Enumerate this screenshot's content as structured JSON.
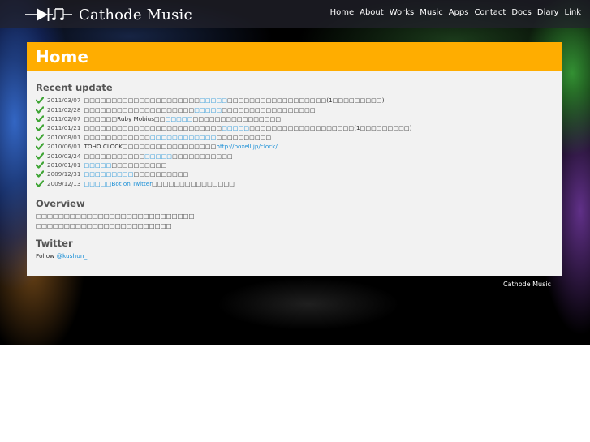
{
  "site": {
    "name": "Cathode Music",
    "logo_icon": "diode-music-note-icon"
  },
  "nav": [
    "Home",
    "About",
    "Works",
    "Music",
    "Apps",
    "Contact",
    "Docs",
    "Diary",
    "Link"
  ],
  "page": {
    "title": "Home"
  },
  "recent": {
    "heading": "Recent update",
    "items": [
      {
        "date": "2011/03/07",
        "pre": "□□□□□□□□□□□□□□□□□□□□□",
        "link": "□□□□□",
        "post": "□□□□□□□□□□□□□□□□□□(1□□□□□□□□□)"
      },
      {
        "date": "2011/02/28",
        "pre": "□□□□□□□□□□□□□□□□□□□□",
        "link": "□□□□□",
        "post": "□□□□□□□□□□□□□□□□□"
      },
      {
        "date": "2011/02/07",
        "pre": "□□□□□□Ruby Mobius□□",
        "link": "□□□□□",
        "post": "□□□□□□□□□□□□□□□□"
      },
      {
        "date": "2011/01/21",
        "pre": "□□□□□□□□□□□□□□□□□□□□□□□□□",
        "link": "□□□□□",
        "post": "□□□□□□□□□□□□□□□□□□□(1□□□□□□□□□)"
      },
      {
        "date": "2010/08/01",
        "pre": "□□□□□□□□□□□□",
        "link": "□□□□□□□□□□□□",
        "post": "□□□□□□□□□□"
      },
      {
        "date": "2010/06/01",
        "pre": "TOHO CLOCK□□□□□□□□□□□□□□□□□ ",
        "link": "http://boxell.jp/clock/",
        "post": ""
      },
      {
        "date": "2010/03/24",
        "pre": "□□□□□□□□□□□",
        "link": "□□□□□",
        "post": "□□□□□□□□□□□"
      },
      {
        "date": "2010/01/01",
        "pre": "",
        "link": "□□□□□",
        "post": "□□□□□□□□□□"
      },
      {
        "date": "2009/12/31",
        "pre": "",
        "link": "□□□□□□□□□",
        "post": "□□□□□□□□□□"
      },
      {
        "date": "2009/12/13",
        "pre": "",
        "link": "□□□□□Bot on Twitter",
        "post": "□□□□□□□□□□□□□□□"
      }
    ]
  },
  "overview": {
    "heading": "Overview",
    "lines": [
      "□□□□□□□□□□□□□□□□□□□□□□□□□□□□",
      "□□□□□□□□□□□□□□□□□□□□□□□□"
    ]
  },
  "twitter": {
    "heading": "Twitter",
    "follow_label": "Follow",
    "handle": "@kushun_"
  },
  "footer": {
    "text": "Cathode Music"
  },
  "colors": {
    "accent": "#ffad00",
    "link": "#1a8fd6",
    "check": "#3fa535",
    "panel_bg": "#f2f2f2"
  }
}
